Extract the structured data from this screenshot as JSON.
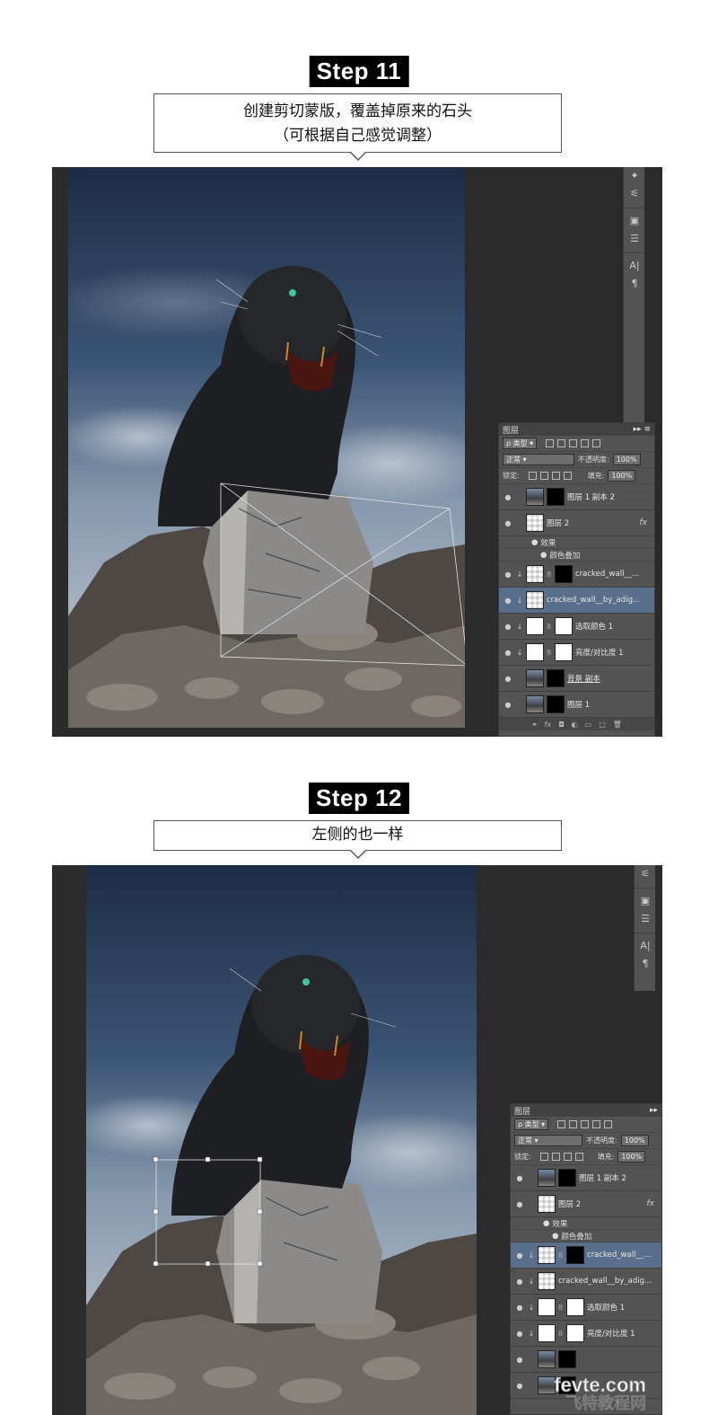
{
  "steps": [
    {
      "badge": "Step 11",
      "caption_line1": "创建剪切蒙版，覆盖掉原来的石头",
      "caption_line2": "（可根据自己感觉调整）"
    },
    {
      "badge": "Step 12",
      "caption_line1": "左侧的也一样"
    }
  ],
  "layers_panel": {
    "title": "图层",
    "filter_label": "类型",
    "blend_mode": "正常",
    "opacity_label": "不透明度:",
    "opacity_value": "100%",
    "lock_label": "锁定:",
    "fill_label": "填充:",
    "fill_value": "100%",
    "layers": [
      {
        "name": "图层 1 副本 2"
      },
      {
        "name": "图层 2",
        "fx": "fx"
      },
      {
        "name": "效果",
        "sub": true
      },
      {
        "name": "颜色叠加",
        "sub": true
      },
      {
        "name": "cracked_wall__..."
      },
      {
        "name": "cracked_wall__by_adig..."
      },
      {
        "name": "选取颜色 1"
      },
      {
        "name": "亮度/对比度 1"
      },
      {
        "name": "背景 副本"
      },
      {
        "name": "图层 1"
      }
    ]
  },
  "watermark": {
    "url": "fevte.com",
    "name": "飞特教程网"
  },
  "colors": {
    "ps_bg": "#2b2b2b",
    "panel_bg": "#535353",
    "selected_row": "#5a6f8b",
    "badge_bg": "#000000"
  }
}
